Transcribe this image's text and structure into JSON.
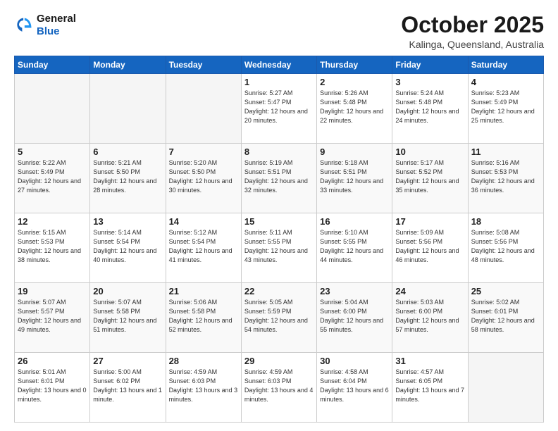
{
  "header": {
    "logo_general": "General",
    "logo_blue": "Blue",
    "month": "October 2025",
    "location": "Kalinga, Queensland, Australia"
  },
  "weekdays": [
    "Sunday",
    "Monday",
    "Tuesday",
    "Wednesday",
    "Thursday",
    "Friday",
    "Saturday"
  ],
  "weeks": [
    [
      {
        "day": "",
        "info": ""
      },
      {
        "day": "",
        "info": ""
      },
      {
        "day": "",
        "info": ""
      },
      {
        "day": "1",
        "info": "Sunrise: 5:27 AM\nSunset: 5:47 PM\nDaylight: 12 hours\nand 20 minutes."
      },
      {
        "day": "2",
        "info": "Sunrise: 5:26 AM\nSunset: 5:48 PM\nDaylight: 12 hours\nand 22 minutes."
      },
      {
        "day": "3",
        "info": "Sunrise: 5:24 AM\nSunset: 5:48 PM\nDaylight: 12 hours\nand 24 minutes."
      },
      {
        "day": "4",
        "info": "Sunrise: 5:23 AM\nSunset: 5:49 PM\nDaylight: 12 hours\nand 25 minutes."
      }
    ],
    [
      {
        "day": "5",
        "info": "Sunrise: 5:22 AM\nSunset: 5:49 PM\nDaylight: 12 hours\nand 27 minutes."
      },
      {
        "day": "6",
        "info": "Sunrise: 5:21 AM\nSunset: 5:50 PM\nDaylight: 12 hours\nand 28 minutes."
      },
      {
        "day": "7",
        "info": "Sunrise: 5:20 AM\nSunset: 5:50 PM\nDaylight: 12 hours\nand 30 minutes."
      },
      {
        "day": "8",
        "info": "Sunrise: 5:19 AM\nSunset: 5:51 PM\nDaylight: 12 hours\nand 32 minutes."
      },
      {
        "day": "9",
        "info": "Sunrise: 5:18 AM\nSunset: 5:51 PM\nDaylight: 12 hours\nand 33 minutes."
      },
      {
        "day": "10",
        "info": "Sunrise: 5:17 AM\nSunset: 5:52 PM\nDaylight: 12 hours\nand 35 minutes."
      },
      {
        "day": "11",
        "info": "Sunrise: 5:16 AM\nSunset: 5:53 PM\nDaylight: 12 hours\nand 36 minutes."
      }
    ],
    [
      {
        "day": "12",
        "info": "Sunrise: 5:15 AM\nSunset: 5:53 PM\nDaylight: 12 hours\nand 38 minutes."
      },
      {
        "day": "13",
        "info": "Sunrise: 5:14 AM\nSunset: 5:54 PM\nDaylight: 12 hours\nand 40 minutes."
      },
      {
        "day": "14",
        "info": "Sunrise: 5:12 AM\nSunset: 5:54 PM\nDaylight: 12 hours\nand 41 minutes."
      },
      {
        "day": "15",
        "info": "Sunrise: 5:11 AM\nSunset: 5:55 PM\nDaylight: 12 hours\nand 43 minutes."
      },
      {
        "day": "16",
        "info": "Sunrise: 5:10 AM\nSunset: 5:55 PM\nDaylight: 12 hours\nand 44 minutes."
      },
      {
        "day": "17",
        "info": "Sunrise: 5:09 AM\nSunset: 5:56 PM\nDaylight: 12 hours\nand 46 minutes."
      },
      {
        "day": "18",
        "info": "Sunrise: 5:08 AM\nSunset: 5:56 PM\nDaylight: 12 hours\nand 48 minutes."
      }
    ],
    [
      {
        "day": "19",
        "info": "Sunrise: 5:07 AM\nSunset: 5:57 PM\nDaylight: 12 hours\nand 49 minutes."
      },
      {
        "day": "20",
        "info": "Sunrise: 5:07 AM\nSunset: 5:58 PM\nDaylight: 12 hours\nand 51 minutes."
      },
      {
        "day": "21",
        "info": "Sunrise: 5:06 AM\nSunset: 5:58 PM\nDaylight: 12 hours\nand 52 minutes."
      },
      {
        "day": "22",
        "info": "Sunrise: 5:05 AM\nSunset: 5:59 PM\nDaylight: 12 hours\nand 54 minutes."
      },
      {
        "day": "23",
        "info": "Sunrise: 5:04 AM\nSunset: 6:00 PM\nDaylight: 12 hours\nand 55 minutes."
      },
      {
        "day": "24",
        "info": "Sunrise: 5:03 AM\nSunset: 6:00 PM\nDaylight: 12 hours\nand 57 minutes."
      },
      {
        "day": "25",
        "info": "Sunrise: 5:02 AM\nSunset: 6:01 PM\nDaylight: 12 hours\nand 58 minutes."
      }
    ],
    [
      {
        "day": "26",
        "info": "Sunrise: 5:01 AM\nSunset: 6:01 PM\nDaylight: 13 hours\nand 0 minutes."
      },
      {
        "day": "27",
        "info": "Sunrise: 5:00 AM\nSunset: 6:02 PM\nDaylight: 13 hours\nand 1 minute."
      },
      {
        "day": "28",
        "info": "Sunrise: 4:59 AM\nSunset: 6:03 PM\nDaylight: 13 hours\nand 3 minutes."
      },
      {
        "day": "29",
        "info": "Sunrise: 4:59 AM\nSunset: 6:03 PM\nDaylight: 13 hours\nand 4 minutes."
      },
      {
        "day": "30",
        "info": "Sunrise: 4:58 AM\nSunset: 6:04 PM\nDaylight: 13 hours\nand 6 minutes."
      },
      {
        "day": "31",
        "info": "Sunrise: 4:57 AM\nSunset: 6:05 PM\nDaylight: 13 hours\nand 7 minutes."
      },
      {
        "day": "",
        "info": ""
      }
    ]
  ]
}
